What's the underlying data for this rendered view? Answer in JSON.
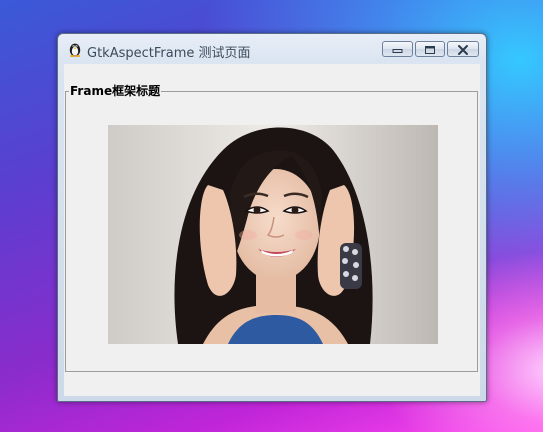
{
  "window": {
    "title": "GtkAspectFrame 测试页面",
    "icon": "gtk-tux-icon"
  },
  "titlebar_buttons": {
    "minimize_icon": "minimize-icon",
    "maximize_icon": "maximize-icon",
    "close_icon": "close-icon"
  },
  "frame": {
    "label": "Frame框架标题"
  },
  "image": {
    "content": "portrait-photo"
  }
}
